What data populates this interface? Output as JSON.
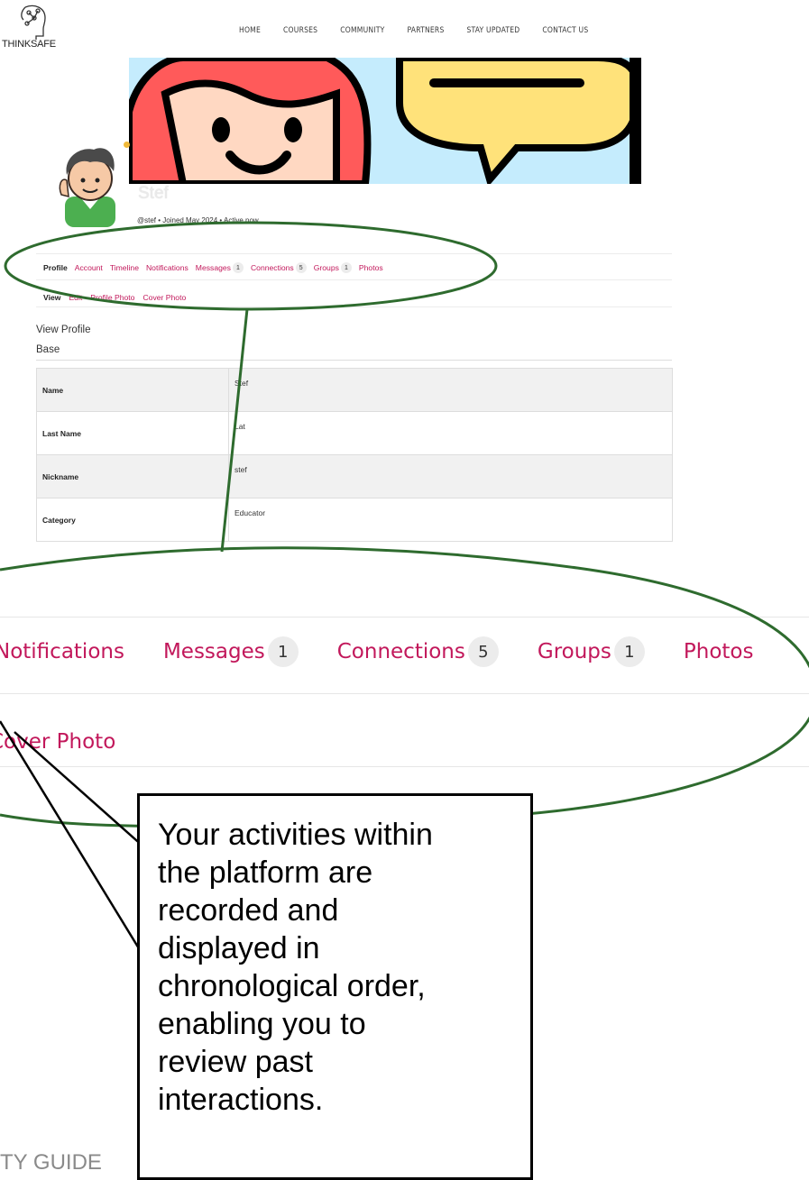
{
  "brand": {
    "name": "THINKSAFE"
  },
  "nav": [
    "HOME",
    "COURSES",
    "COMMUNITY",
    "PARTNERS",
    "STAY UPDATED",
    "CONTACT US"
  ],
  "profile": {
    "username": "Stef",
    "meta": "@stef • Joined May 2024 • Active now"
  },
  "tabs": [
    {
      "label": "Profile",
      "active": true
    },
    {
      "label": "Account"
    },
    {
      "label": "Timeline"
    },
    {
      "label": "Notifications"
    },
    {
      "label": "Messages",
      "badge": "1"
    },
    {
      "label": "Connections",
      "badge": "5"
    },
    {
      "label": "Groups",
      "badge": "1"
    },
    {
      "label": "Photos"
    }
  ],
  "subtabs": [
    {
      "label": "View",
      "active": true
    },
    {
      "label": "Edit"
    },
    {
      "label": "Profile Photo"
    },
    {
      "label": "Cover Photo"
    }
  ],
  "view_title": "View Profile",
  "section_title": "Base",
  "fields": [
    {
      "key": "Name",
      "value": "Stef"
    },
    {
      "key": "Last Name",
      "value": "Lat"
    },
    {
      "key": "Nickname",
      "value": "stef"
    },
    {
      "key": "Category",
      "value": "Educator"
    }
  ],
  "zoom": {
    "tabs": [
      {
        "label": "Notifications"
      },
      {
        "label": "Messages",
        "badge": "1"
      },
      {
        "label": "Connections",
        "badge": "5"
      },
      {
        "label": "Groups",
        "badge": "1"
      },
      {
        "label": "Photos"
      }
    ],
    "sub": "Cover Photo"
  },
  "callout": {
    "lines": [
      "Your activities within",
      "the platform are",
      "recorded and",
      "displayed in",
      "chronological order,",
      "enabling you to",
      "review past",
      "interactions."
    ]
  },
  "footer": "TY GUIDE",
  "colors": {
    "link": "#c2185b",
    "highlight": "#2e6b2e"
  }
}
